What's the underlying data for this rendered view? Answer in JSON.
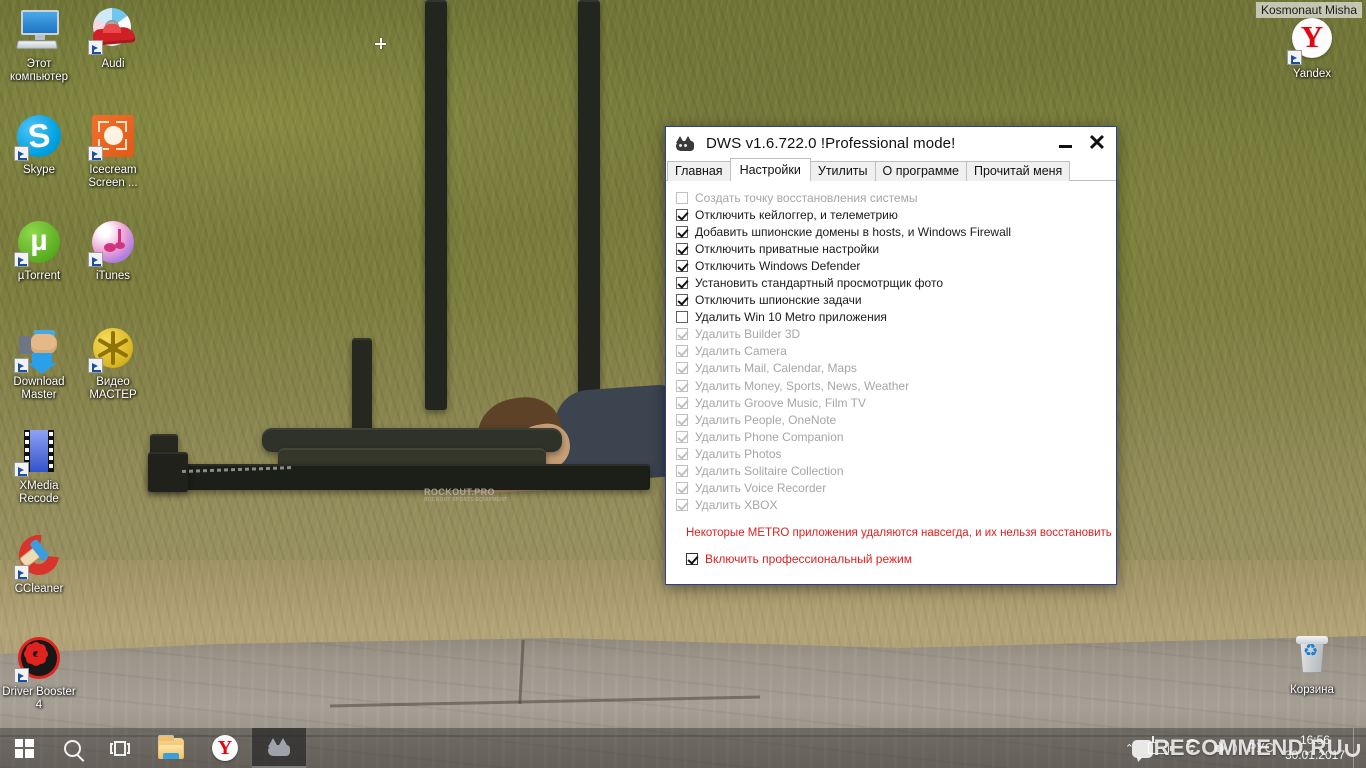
{
  "desktop": {
    "user_label": "Kosmonaut Misha",
    "wallpaper_text": "ROCKOUT.PRO",
    "wallpaper_subtext": "ROCKOUT SPORTS EQUIPMENT",
    "icons_left": [
      {
        "name": "this-pc",
        "label": "Этот\nкомпьютер",
        "icon": "computer-icon",
        "shortcut": false
      },
      {
        "name": "audi",
        "label": "Audi",
        "icon": "audi-game-icon",
        "shortcut": true
      },
      {
        "name": "skype",
        "label": "Skype",
        "icon": "skype-icon",
        "shortcut": true
      },
      {
        "name": "icecream-screen",
        "label": "Icecream\nScreen ...",
        "icon": "icecream-recorder-icon",
        "shortcut": true
      },
      {
        "name": "utorrent",
        "label": "µTorrent",
        "icon": "utorrent-icon",
        "shortcut": true
      },
      {
        "name": "itunes",
        "label": "iTunes",
        "icon": "itunes-icon",
        "shortcut": true
      },
      {
        "name": "download-master",
        "label": "Download\nMaster",
        "icon": "download-master-icon",
        "shortcut": true
      },
      {
        "name": "video-master",
        "label": "Видео\nМАСТЕР",
        "icon": "film-reel-icon",
        "shortcut": true
      },
      {
        "name": "xmedia-recode",
        "label": "XMedia\nRecode",
        "icon": "film-strip-icon",
        "shortcut": true
      },
      {
        "name": "ccleaner",
        "label": "CCleaner",
        "icon": "ccleaner-icon",
        "shortcut": true
      },
      {
        "name": "driver-booster",
        "label": "Driver\nBooster 4",
        "icon": "driver-booster-icon",
        "shortcut": true
      }
    ],
    "icons_right": [
      {
        "name": "yandex",
        "label": "Yandex",
        "icon": "yandex-browser-icon",
        "shortcut": true
      },
      {
        "name": "recycle-bin",
        "label": "Корзина",
        "icon": "recycle-bin-icon",
        "shortcut": false
      }
    ]
  },
  "window": {
    "title": "DWS v1.6.722.0  !Professional mode!",
    "app_icon": "dws-cat-icon",
    "minimize_label": "−",
    "close_label": "✕",
    "accent_border": "#2b3fa0",
    "warning_color": "#e02020",
    "tabs": [
      {
        "label": "Главная",
        "active": false
      },
      {
        "label": "Настройки",
        "active": true
      },
      {
        "label": "Утилиты",
        "active": false
      },
      {
        "label": "О программе",
        "active": false
      },
      {
        "label": "Прочитай меня",
        "active": false
      }
    ],
    "options": [
      {
        "label": "Создать точку восстановления системы",
        "checked": false,
        "disabled": true
      },
      {
        "label": "Отключить кейлоггер, и телеметрию",
        "checked": true,
        "disabled": false
      },
      {
        "label": "Добавить шпионские домены в hosts, и Windows Firewall",
        "checked": true,
        "disabled": false
      },
      {
        "label": "Отключить приватные настройки",
        "checked": true,
        "disabled": false
      },
      {
        "label": "Отключить Windows Defender",
        "checked": true,
        "disabled": false
      },
      {
        "label": "Установить стандартный просмотрщик фото",
        "checked": true,
        "disabled": false
      },
      {
        "label": "Отключить шпионские задачи",
        "checked": true,
        "disabled": false
      },
      {
        "label": "Удалить Win 10 Metro приложения",
        "checked": false,
        "disabled": false
      },
      {
        "label": "Удалить Builder 3D",
        "checked": true,
        "disabled": true
      },
      {
        "label": "Удалить Camera",
        "checked": true,
        "disabled": true
      },
      {
        "label": "Удалить Mail, Calendar, Maps",
        "checked": true,
        "disabled": true
      },
      {
        "label": "Удалить Money, Sports, News, Weather",
        "checked": true,
        "disabled": true
      },
      {
        "label": "Удалить Groove Music, Film TV",
        "checked": true,
        "disabled": true
      },
      {
        "label": "Удалить People, OneNote",
        "checked": true,
        "disabled": true
      },
      {
        "label": "Удалить Phone Companion",
        "checked": true,
        "disabled": true
      },
      {
        "label": "Удалить Photos",
        "checked": true,
        "disabled": true
      },
      {
        "label": "Удалить Solitaire Collection",
        "checked": true,
        "disabled": true
      },
      {
        "label": "Удалить Voice Recorder",
        "checked": true,
        "disabled": true
      },
      {
        "label": "Удалить XBOX",
        "checked": true,
        "disabled": true
      }
    ],
    "warning": "Некоторые METRO приложения удаляются навсегда, и их нельзя восстановить",
    "pro_mode": {
      "label": "Включить профессиональный режим",
      "checked": true
    }
  },
  "taskbar": {
    "start": "start-button",
    "buttons": [
      {
        "name": "search-button",
        "icon": "search-icon"
      },
      {
        "name": "task-view-button",
        "icon": "task-view-icon"
      },
      {
        "name": "file-explorer",
        "icon": "folder-icon"
      },
      {
        "name": "yandex-browser",
        "icon": "yandex-icon"
      },
      {
        "name": "dws-app",
        "icon": "dws-cat-icon",
        "active": true
      }
    ],
    "tray": {
      "chevron": "⌃",
      "battery": "battery-charging-icon",
      "wifi": "wifi-icon",
      "volume": "volume-icon",
      "language": "РУС"
    },
    "clock": {
      "time": "16:56",
      "date": "30.01.2017"
    }
  },
  "watermark": {
    "text": "RECOMMEND.RU"
  }
}
